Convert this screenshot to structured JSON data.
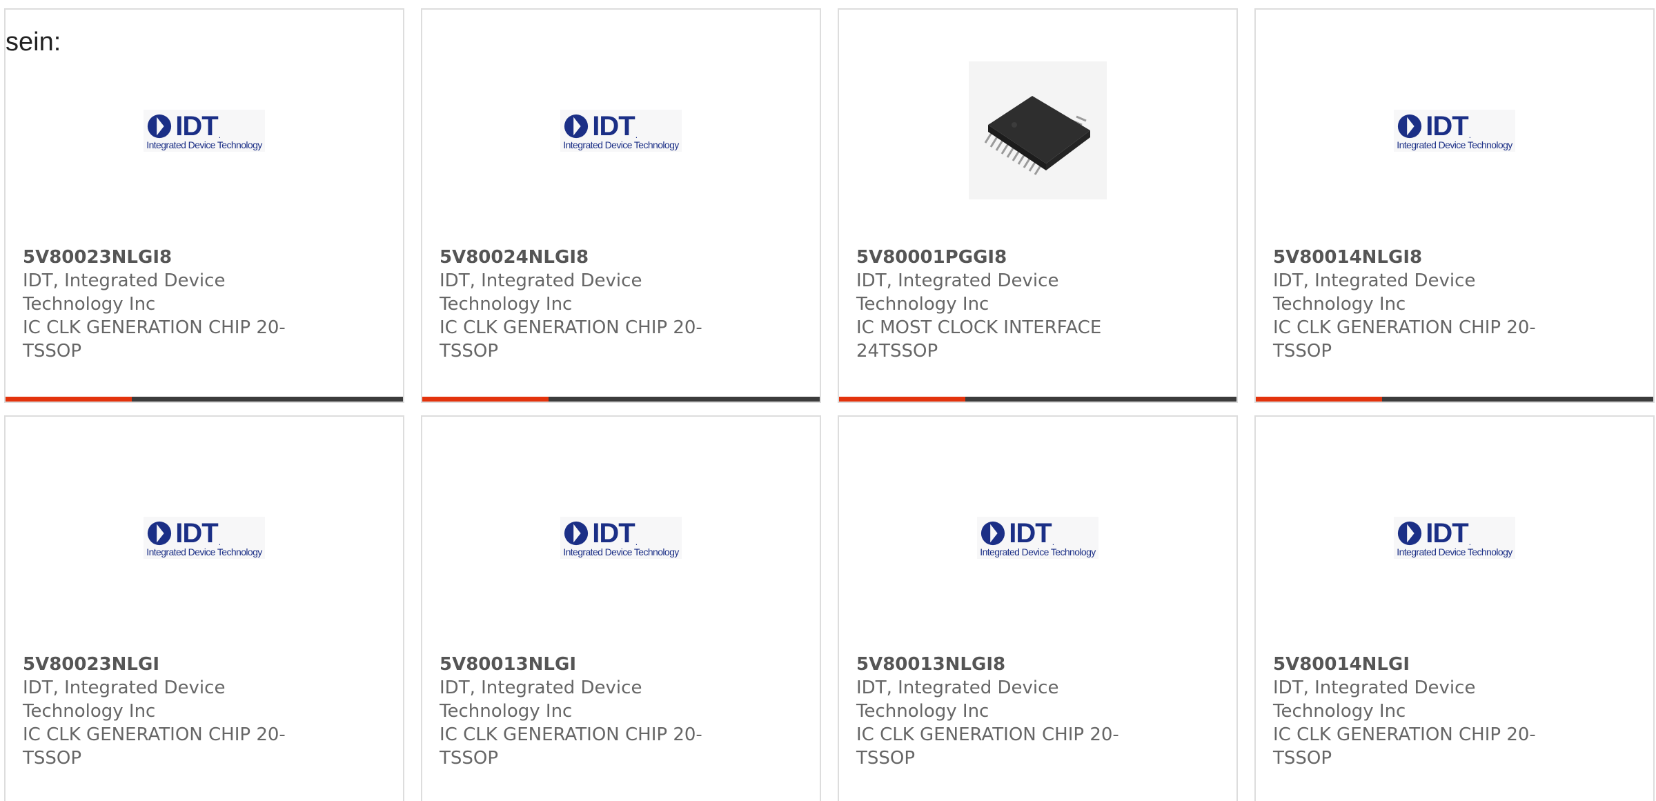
{
  "intro_text": "sein:",
  "colors": {
    "accent_red": "#e3330c",
    "accent_dark": "#3c3c3c",
    "border": "#dddddd",
    "text": "#666666",
    "logo_blue": "#1b2f86"
  },
  "logo": {
    "word": "IDT",
    "dot": ".",
    "subtitle": "Integrated Device Technology"
  },
  "cards": [
    {
      "part_number": "5V80023NLGI8",
      "manufacturer_line1": "IDT, Integrated Device",
      "manufacturer_line2": "Technology Inc",
      "description_line1": "IC CLK GENERATION CHIP 20-",
      "description_line2": "TSSOP",
      "image": "idt-logo"
    },
    {
      "part_number": "5V80024NLGI8",
      "manufacturer_line1": "IDT, Integrated Device",
      "manufacturer_line2": "Technology Inc",
      "description_line1": "IC CLK GENERATION CHIP 20-",
      "description_line2": "TSSOP",
      "image": "idt-logo"
    },
    {
      "part_number": "5V80001PGGI8",
      "manufacturer_line1": "IDT, Integrated Device",
      "manufacturer_line2": "Technology Inc",
      "description_line1": "IC MOST CLOCK INTERFACE",
      "description_line2": "24TSSOP",
      "image": "tssop-chip-photo"
    },
    {
      "part_number": "5V80014NLGI8",
      "manufacturer_line1": "IDT, Integrated Device",
      "manufacturer_line2": "Technology Inc",
      "description_line1": "IC CLK GENERATION CHIP 20-",
      "description_line2": "TSSOP",
      "image": "idt-logo"
    },
    {
      "part_number": "5V80023NLGI",
      "manufacturer_line1": "IDT, Integrated Device",
      "manufacturer_line2": "Technology Inc",
      "description_line1": "IC CLK GENERATION CHIP 20-",
      "description_line2": "TSSOP",
      "image": "idt-logo"
    },
    {
      "part_number": "5V80013NLGI",
      "manufacturer_line1": "IDT, Integrated Device",
      "manufacturer_line2": "Technology Inc",
      "description_line1": "IC CLK GENERATION CHIP 20-",
      "description_line2": "TSSOP",
      "image": "idt-logo"
    },
    {
      "part_number": "5V80013NLGI8",
      "manufacturer_line1": "IDT, Integrated Device",
      "manufacturer_line2": "Technology Inc",
      "description_line1": "IC CLK GENERATION CHIP 20-",
      "description_line2": "TSSOP",
      "image": "idt-logo"
    },
    {
      "part_number": "5V80014NLGI",
      "manufacturer_line1": "IDT, Integrated Device",
      "manufacturer_line2": "Technology Inc",
      "description_line1": "IC CLK GENERATION CHIP 20-",
      "description_line2": "TSSOP",
      "image": "idt-logo"
    }
  ]
}
